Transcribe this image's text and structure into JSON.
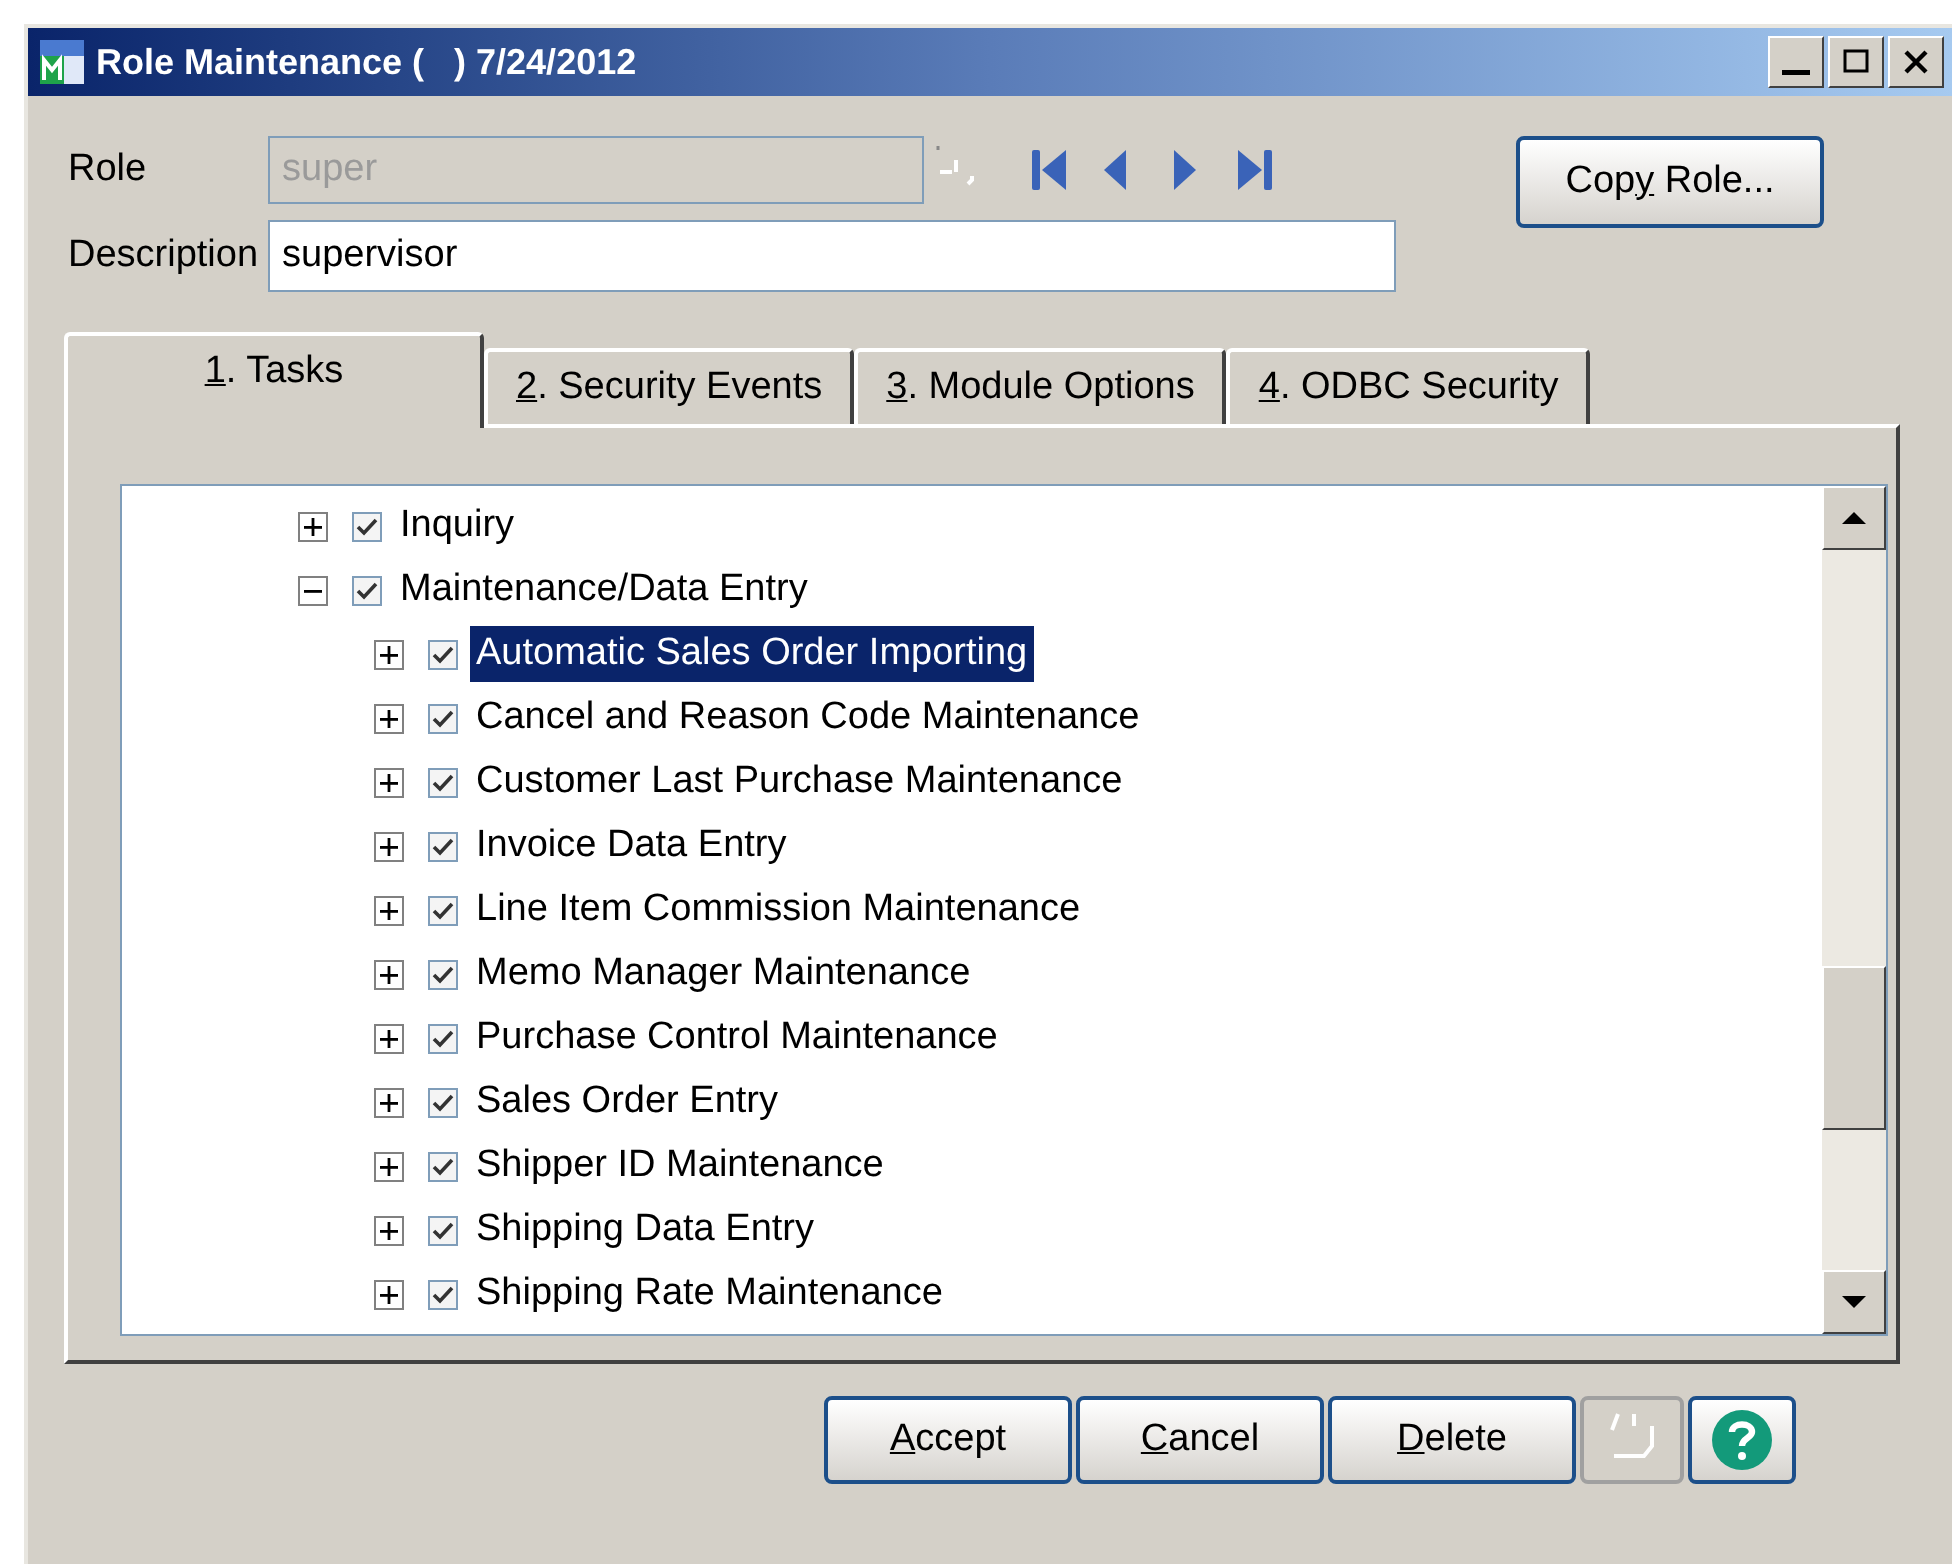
{
  "window": {
    "title": "Role Maintenance (   ) 7/24/2012"
  },
  "role": {
    "label": "Role",
    "value": "super",
    "disabled": true
  },
  "description": {
    "label": "Description",
    "value": "supervisor"
  },
  "copy_button": {
    "pre": "Cop",
    "key": "y",
    "post": " Role..."
  },
  "tabs": [
    {
      "key": "1",
      "rest": ". Tasks",
      "selected": true
    },
    {
      "key": "2",
      "rest": ". Security Events",
      "selected": false
    },
    {
      "key": "3",
      "rest": ". Module Options",
      "selected": false
    },
    {
      "key": "4",
      "rest": ". ODBC Security",
      "selected": false
    }
  ],
  "tree": [
    {
      "label": "Inquiry",
      "checked": true,
      "expanded": false,
      "selected": false
    },
    {
      "label": "Maintenance/Data Entry",
      "checked": true,
      "expanded": true,
      "selected": false,
      "children": [
        {
          "label": "Automatic Sales Order Importing",
          "checked": true,
          "expanded": false,
          "selected": true
        },
        {
          "label": "Cancel and Reason Code Maintenance",
          "checked": true,
          "expanded": false,
          "selected": false
        },
        {
          "label": "Customer Last Purchase Maintenance",
          "checked": true,
          "expanded": false,
          "selected": false
        },
        {
          "label": "Invoice Data Entry",
          "checked": true,
          "expanded": false,
          "selected": false
        },
        {
          "label": "Line Item Commission Maintenance",
          "checked": true,
          "expanded": false,
          "selected": false
        },
        {
          "label": "Memo Manager Maintenance",
          "checked": true,
          "expanded": false,
          "selected": false
        },
        {
          "label": "Purchase Control Maintenance",
          "checked": true,
          "expanded": false,
          "selected": false
        },
        {
          "label": "Sales Order Entry",
          "checked": true,
          "expanded": false,
          "selected": false
        },
        {
          "label": "Shipper ID Maintenance",
          "checked": true,
          "expanded": false,
          "selected": false
        },
        {
          "label": "Shipping Data Entry",
          "checked": true,
          "expanded": false,
          "selected": false
        },
        {
          "label": "Shipping Rate Maintenance",
          "checked": true,
          "expanded": false,
          "selected": false
        }
      ]
    }
  ],
  "buttons": [
    {
      "key": "A",
      "rest": "ccept"
    },
    {
      "key": "C",
      "rest": "ancel"
    },
    {
      "key": "D",
      "rest": "elete"
    }
  ]
}
